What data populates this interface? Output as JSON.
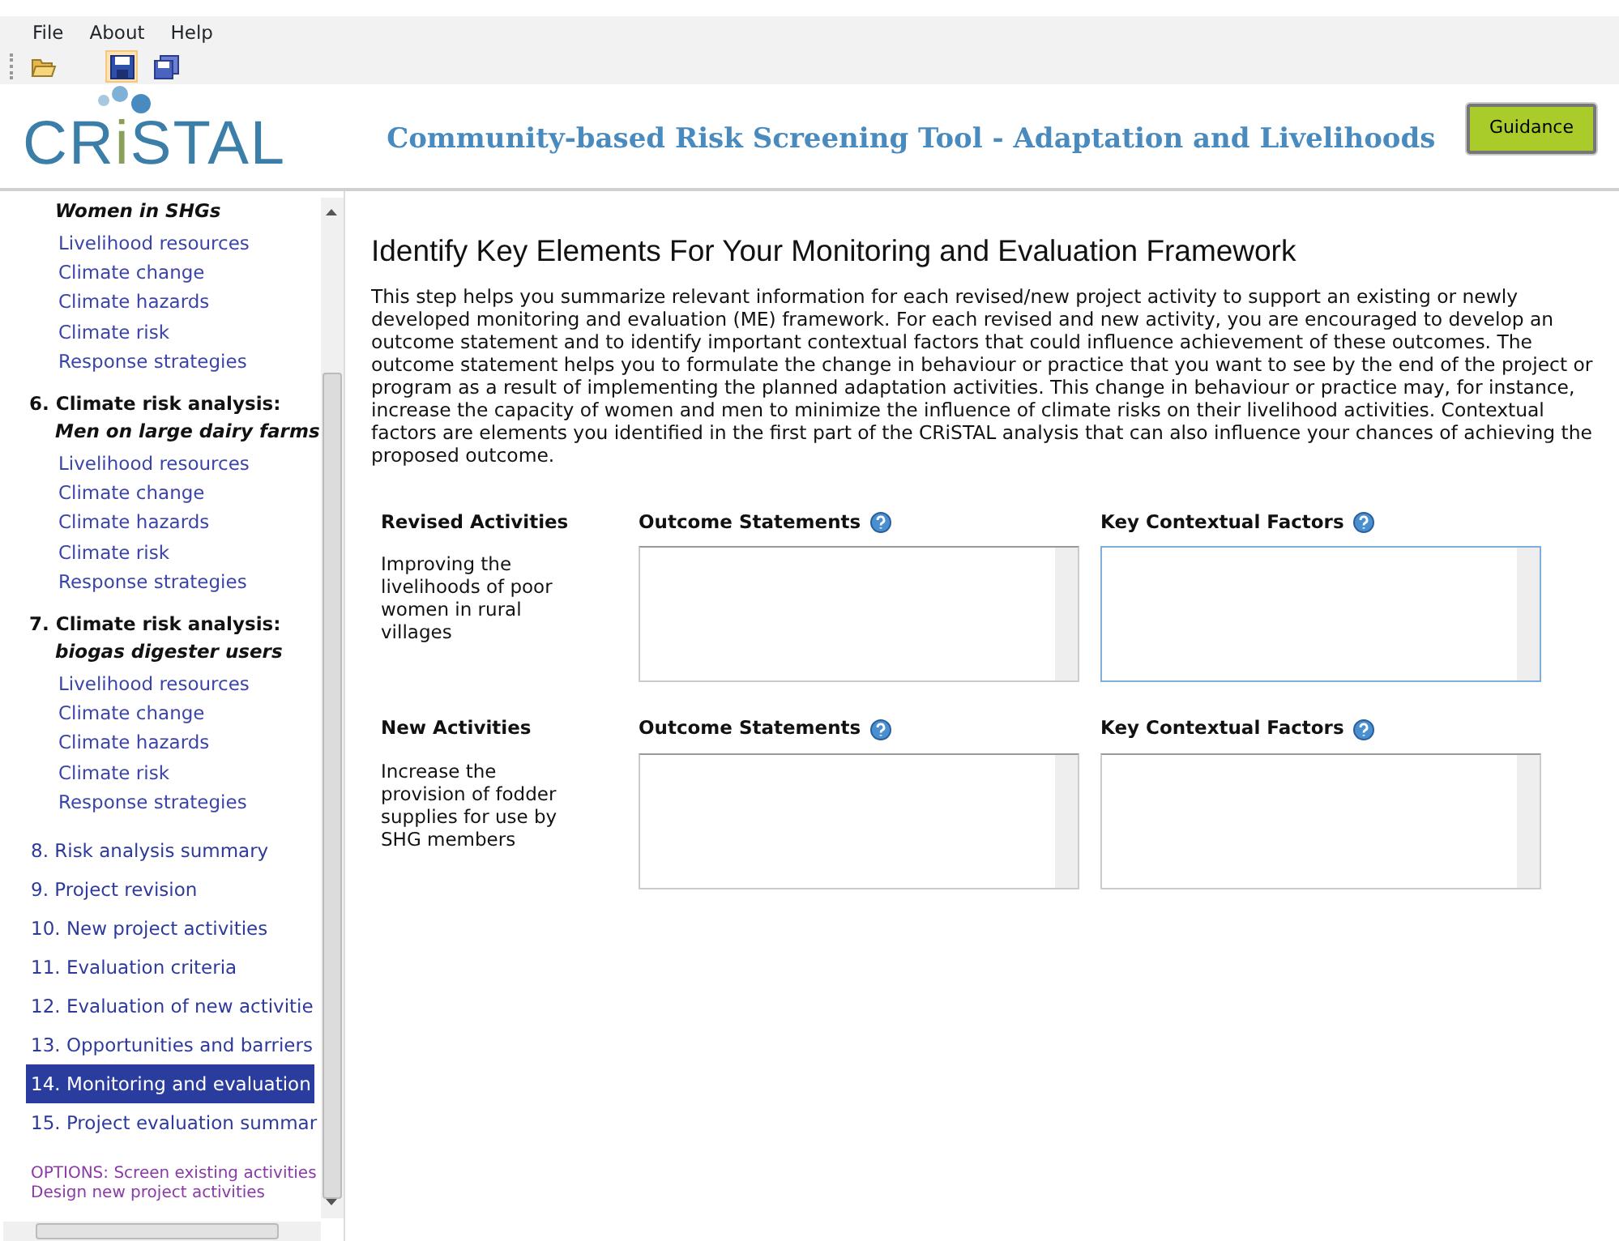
{
  "menu": [
    "File",
    "About",
    "Help"
  ],
  "toolbar": [
    {
      "kind": "open",
      "selected": false
    },
    {
      "kind": "save",
      "selected": true
    },
    {
      "kind": "save-all",
      "selected": false
    }
  ],
  "logo": {
    "parts": [
      {
        "text": "CR",
        "color": "#3b7fa8"
      },
      {
        "text": "i",
        "color": "#8aa05a"
      },
      {
        "text": "STAL",
        "color": "#3b7fa8"
      }
    ]
  },
  "title": "Community-based Risk Screening Tool - Adaptation and Livelihoods",
  "guidance_button": "Guidance",
  "sidebar": {
    "sections": [
      {
        "subtitle": "Women in SHGs",
        "items": [
          "Livelihood resources",
          "Climate change",
          "Climate hazards",
          "Climate risk",
          "Response strategies"
        ]
      },
      {
        "title": "6. Climate risk analysis:",
        "subtitle": "Men on large dairy farms",
        "items": [
          "Livelihood resources",
          "Climate change",
          "Climate hazards",
          "Climate risk",
          "Response strategies"
        ]
      },
      {
        "title": "7. Climate risk analysis:",
        "subtitle": "biogas digester users",
        "items": [
          "Livelihood resources",
          "Climate change",
          "Climate hazards",
          "Climate risk",
          "Response strategies"
        ]
      }
    ],
    "steps": [
      {
        "label": "8. Risk analysis summary",
        "selected": false
      },
      {
        "label": "9. Project revision",
        "selected": false
      },
      {
        "label": "10. New project activities",
        "selected": false
      },
      {
        "label": "11. Evaluation criteria",
        "selected": false
      },
      {
        "label": "12. Evaluation of new activitie",
        "selected": false
      },
      {
        "label": "13. Opportunities and barriers",
        "selected": false
      },
      {
        "label": "14. Monitoring and evaluation",
        "selected": true
      },
      {
        "label": "15. Project evaluation summar",
        "selected": false
      }
    ],
    "options": [
      "OPTIONS: Screen existing activities",
      "Design new project activities"
    ]
  },
  "heading": "Identify Key Elements For Your Monitoring and Evaluation Framework",
  "intro": "This step helps you summarize relevant information for each revised/new project activity to support an existing or newly developed monitoring and evaluation (ME) framework. For each revised and new activity, you are encouraged to develop an outcome statement and to identify important contextual factors that could influence achievement of these outcomes. The outcome statement helps you to formulate the change in behaviour or practice that you want to see by the end of the project or program as a result of implementing the planned adaptation activities. This change in behaviour or practice may, for instance, increase the capacity of women and men to minimize the influence of climate risks on their livelihood activities. Contextual factors are elements you identified in the first part of the CRiSTAL analysis that can also influence your chances of achieving the proposed outcome.",
  "groups": [
    {
      "label": "Revised Activities",
      "activity": "Improving the livelihoods of poor women in rural villages",
      "columns": [
        {
          "label": "Outcome Statements",
          "focused": false
        },
        {
          "label": "Key Contextual Factors",
          "focused": true
        }
      ]
    },
    {
      "label": "New Activities",
      "activity": "Increase the provision of fodder supplies for use by SHG members",
      "columns": [
        {
          "label": "Outcome Statements",
          "focused": false
        },
        {
          "label": "Key Contextual Factors",
          "focused": false
        }
      ]
    }
  ]
}
